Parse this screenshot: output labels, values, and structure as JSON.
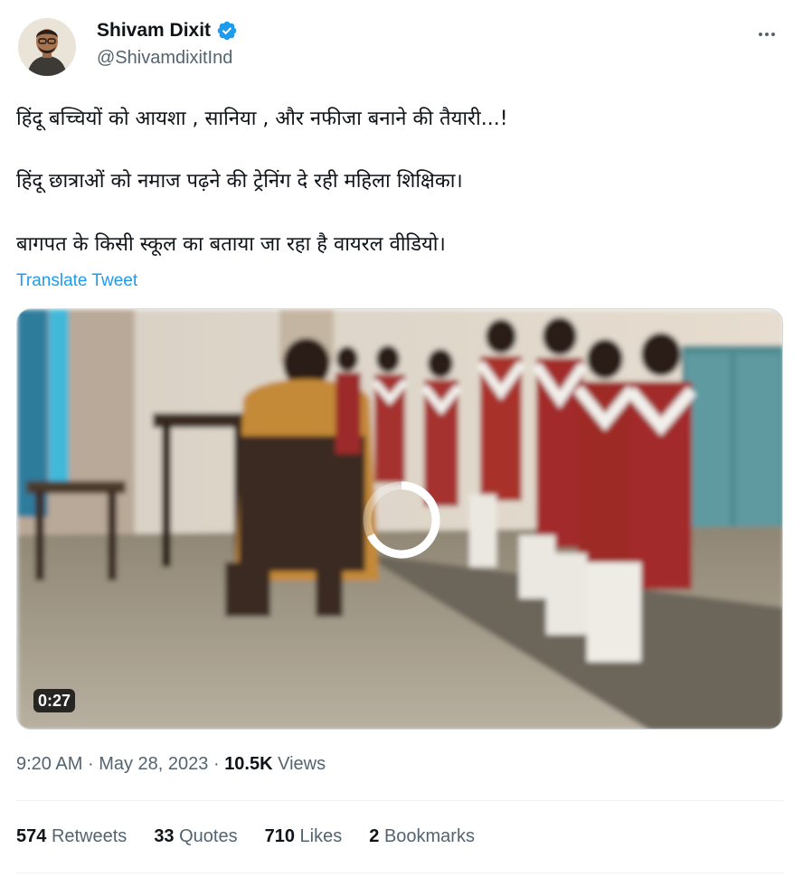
{
  "author": {
    "display_name": "Shivam Dixit",
    "handle": "@ShivamdixitInd",
    "verified": true,
    "avatar_icon": "profile-photo"
  },
  "tweet": {
    "lines": [
      "हिंदू बच्चियों को आयशा , सानिया , और नफीजा बनाने की तैयारी...!",
      "हिंदू छात्राओं को नमाज पढ़ने की ट्रेनिंग दे रही महिला शिक्षिका।",
      "बागपत के किसी स्कूल का बताया जा रहा है वायरल वीडियो।"
    ],
    "translate_label": "Translate Tweet"
  },
  "media": {
    "type": "video",
    "duration": "0:27",
    "state": "loading"
  },
  "meta": {
    "time": "9:20 AM",
    "separator": "·",
    "date": "May 28, 2023",
    "views_count": "10.5K",
    "views_label": "Views"
  },
  "stats": [
    {
      "count": "574",
      "label": "Retweets"
    },
    {
      "count": "33",
      "label": "Quotes"
    },
    {
      "count": "710",
      "label": "Likes"
    },
    {
      "count": "2",
      "label": "Bookmarks"
    }
  ],
  "colors": {
    "link": "#1d9bf0",
    "secondary_text": "#536471",
    "primary_text": "#0f1419",
    "verified_badge": "#1d9bf0"
  },
  "icons": {
    "more": "more-dots-icon",
    "verified": "verified-badge-icon"
  }
}
